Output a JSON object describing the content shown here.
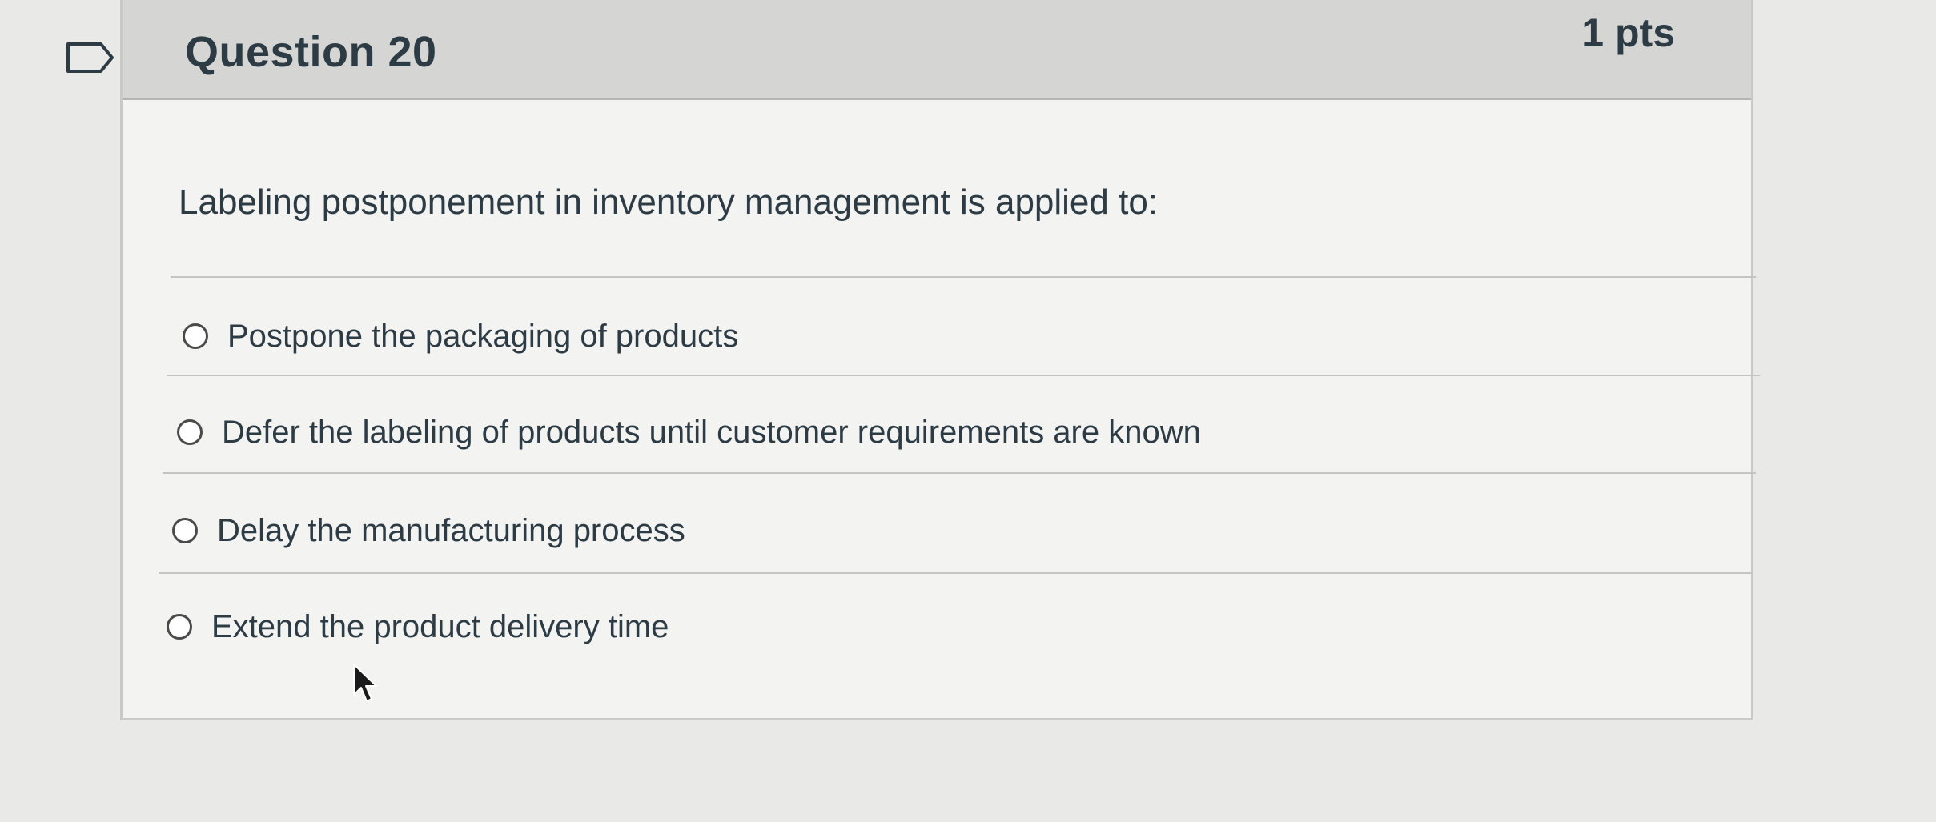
{
  "question": {
    "title": "Question 20",
    "points": "1 pts",
    "prompt": "Labeling postponement in inventory management is applied to:",
    "answers": [
      {
        "label": "Postpone the packaging of products",
        "selected": false
      },
      {
        "label": "Defer the labeling of products until customer requirements are known",
        "selected": false
      },
      {
        "label": "Delay the manufacturing process",
        "selected": false
      },
      {
        "label": "Extend the product delivery time",
        "selected": false
      }
    ]
  },
  "icons": {
    "flag": "flag-icon",
    "radio": "radio-icon",
    "cursor": "mouse-cursor-icon"
  },
  "colors": {
    "header_bg": "#d5d6d4",
    "card_bg": "#f3f3f1",
    "text": "#2d3b45"
  }
}
